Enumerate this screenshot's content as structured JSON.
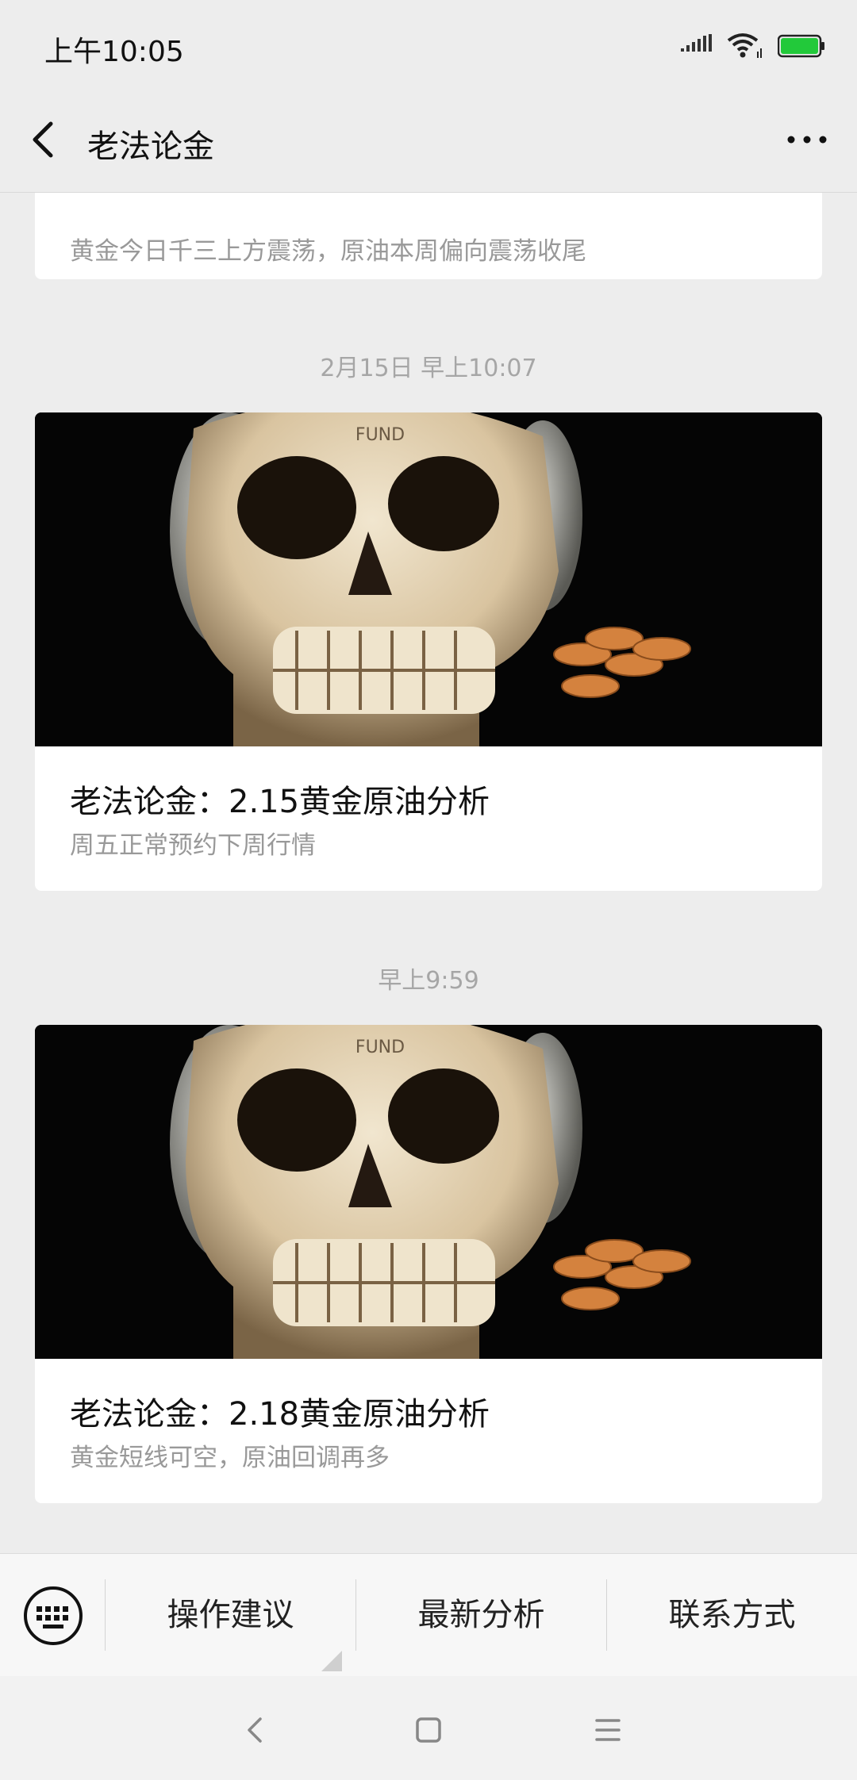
{
  "status_bar": {
    "time": "上午10:05",
    "battery_color": "#22c93a"
  },
  "nav": {
    "title": "老法论金",
    "back_icon": "back-icon",
    "more_icon": "more-icon"
  },
  "articles": [
    {
      "digest": "黄金今日千三上方震荡，原油本周偏向震荡收尾",
      "partial": true
    },
    {
      "time": "2月15日 早上10:07",
      "cover_text": "FUND",
      "title": "老法论金：2.15黄金原油分析",
      "digest": "周五正常预约下周行情"
    },
    {
      "time": "早上9:59",
      "cover_text": "FUND",
      "title": "老法论金：2.18黄金原油分析",
      "digest": "黄金短线可空，原油回调再多"
    }
  ],
  "menu": {
    "keyboard_icon": "keyboard-icon",
    "items": [
      {
        "label": "操作建议",
        "has_submenu": true
      },
      {
        "label": "最新分析"
      },
      {
        "label": "联系方式"
      }
    ]
  },
  "system_nav": {
    "buttons": [
      "back-icon",
      "home-icon",
      "recents-icon"
    ]
  }
}
